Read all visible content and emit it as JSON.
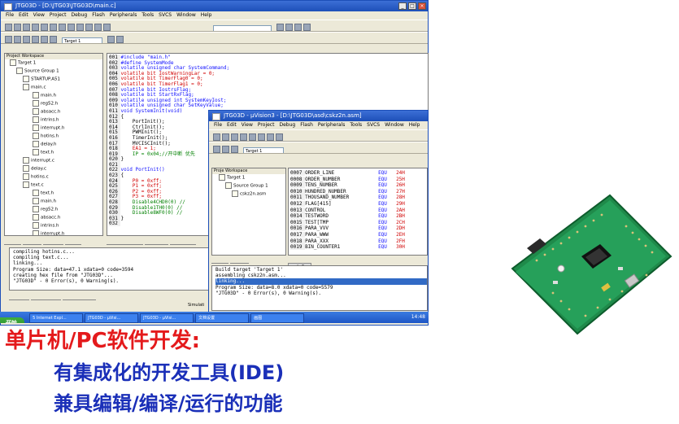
{
  "main_window": {
    "title": "JTG03D - [D:\\JTG03\\JTG03D\\main.c]",
    "menu": [
      "File",
      "Edit",
      "View",
      "Project",
      "Debug",
      "Flash",
      "Peripherals",
      "Tools",
      "SVCS",
      "Window",
      "Help"
    ],
    "target": "Target 1",
    "project_workspace_label": "Project Workspace",
    "tree": [
      "Target 1",
      "Source Group 1",
      "STARTUP.A51",
      "main.c",
      "main.h",
      "reg52.h",
      "absacc.h",
      "intrins.h",
      "interrupt.h",
      "hotins.h",
      "delay.h",
      "text.h",
      "interrupt.c",
      "delay.c",
      "hotins.c",
      "text.c",
      "text.h",
      "main.h",
      "reg52.h",
      "absacc.h",
      "intrins.h",
      "interrupt.h",
      "hotins.h",
      "delay.h"
    ],
    "code_lines": [
      {
        "n": "001",
        "t": "#include \"main.h\""
      },
      {
        "n": "002",
        "t": "#define SystemMode"
      },
      {
        "n": "003",
        "t": "volatile unsigned char SystemCommand;"
      },
      {
        "n": "004",
        "t": "volatile bit IostWarningLar = 0;"
      },
      {
        "n": "005",
        "t": "volatile bit TimerFlag0 = 0;"
      },
      {
        "n": "006",
        "t": "volatile bit TimerFlag1 = 0;"
      },
      {
        "n": "007",
        "t": "volatile bit IostrsFlag;"
      },
      {
        "n": "008",
        "t": "volatile bit StartRxFlag;"
      },
      {
        "n": "009",
        "t": "volatile unsigned int SystemKeyIost;"
      },
      {
        "n": "010",
        "t": "volatile unsigned char SetKeyValue;"
      },
      {
        "n": "011",
        "t": "void SystemInit(void)"
      },
      {
        "n": "012",
        "t": "{"
      },
      {
        "n": "013",
        "t": "    PortInit();"
      },
      {
        "n": "014",
        "t": "    CtrlInit();"
      },
      {
        "n": "015",
        "t": "    PWMInit();"
      },
      {
        "n": "016",
        "t": "    TimerInit();"
      },
      {
        "n": "017",
        "t": "    MVCISCInit();"
      },
      {
        "n": "018",
        "t": "    EA1 = 1;"
      },
      {
        "n": "019",
        "t": "    IP = 0x04;//开中断 优先"
      },
      {
        "n": "020",
        "t": "}"
      },
      {
        "n": "021",
        "t": ""
      },
      {
        "n": "022",
        "t": "void PortInit()"
      },
      {
        "n": "023",
        "t": "{"
      },
      {
        "n": "024",
        "t": "    P0 = 0xff;"
      },
      {
        "n": "025",
        "t": "    P1 = 0xff;"
      },
      {
        "n": "026",
        "t": "    P2 = 0xff;"
      },
      {
        "n": "027",
        "t": "    P3 = 0xff;"
      },
      {
        "n": "028",
        "t": "    Disable4CHD0(0) //"
      },
      {
        "n": "029",
        "t": "    Disable1TH0(0) //"
      },
      {
        "n": "030",
        "t": "    Disable8WF0(0) //"
      },
      {
        "n": "031",
        "t": "}"
      },
      {
        "n": "032",
        "t": ""
      }
    ],
    "left_tabs": [
      "Fi...",
      "Bo...",
      "{}F...",
      "0..."
    ],
    "editor_tabs": [
      "STARTUP.A51",
      "main.c",
      "interrup"
    ],
    "output_lines": [
      "compiling hotins.c...",
      "compiling text.c...",
      "linking...",
      "Program Size: data=47.1 xdata=0 code=3594",
      "creating hex file from \"JTG03D\"...",
      "\"JTG03D\" - 0 Error(s), 0 Warning(s)."
    ],
    "output_tabs": [
      "Build",
      "Command",
      "Find in Files"
    ]
  },
  "second_window": {
    "title": "JTG03D - μVision3 - [D:\\JTG03D\\asd\\cskz2n.asm]",
    "menu": [
      "File",
      "Edit",
      "View",
      "Project",
      "Debug",
      "Flash",
      "Peripherals",
      "Tools",
      "SVCS",
      "Window",
      "Help"
    ],
    "target": "Target 1",
    "workspace_label": "Proje Workspace",
    "tree": [
      "Target 1",
      "Source Group 1",
      "cskz2n.asm"
    ],
    "asm_lines": [
      {
        "n": "0007",
        "a": "ORDER_LINE",
        "op": "EQU",
        "v": "24H"
      },
      {
        "n": "0008",
        "a": "ORDER_NUMBER",
        "op": "EQU",
        "v": "25H"
      },
      {
        "n": "0009",
        "a": "TENS_NUMBER",
        "op": "EQU",
        "v": "26H"
      },
      {
        "n": "0010",
        "a": "HUNDRED_NUMBER",
        "op": "EQU",
        "v": "27H"
      },
      {
        "n": "0011",
        "a": "THOUSAND_NUMBER",
        "op": "EQU",
        "v": "28H"
      },
      {
        "n": "0012",
        "a": "FLAG[415]",
        "op": "EQU",
        "v": "29H"
      },
      {
        "n": "0013",
        "a": "CONTROL",
        "op": "EQU",
        "v": "2AH"
      },
      {
        "n": "0014",
        "a": "TESTWORD",
        "op": "EQU",
        "v": "2BH"
      },
      {
        "n": "0015",
        "a": "TEST[TMP",
        "op": "EQU",
        "v": "2CH"
      },
      {
        "n": "0016",
        "a": "PARA_VVV",
        "op": "EQU",
        "v": "2DH"
      },
      {
        "n": "0017",
        "a": "PARA_WWW",
        "op": "EQU",
        "v": "2EH"
      },
      {
        "n": "0018",
        "a": "PARA_XXX",
        "op": "EQU",
        "v": "2FH"
      },
      {
        "n": "0019",
        "a": "BIN_COUNTER1",
        "op": "EQU",
        "v": "30H"
      }
    ],
    "left_tabs": [
      "Fi...",
      "Re..."
    ],
    "editor_tab": "cskz2n",
    "output_lines": [
      "Build target 'Target 1'",
      "assembling cskz2n.asm...",
      "linking...",
      "Program Size: data=8.0 xdata=0 code=5579",
      "\"JTG03D\" - 0 Error(s), 0 Warning(s)."
    ]
  },
  "taskbar": {
    "start": "开始",
    "tasks": [
      "5 Internet Expl...",
      "JTG03D - μVisi...",
      "JTG03D - μVisi...",
      "文档设置",
      "画图"
    ],
    "clock": "14:48"
  },
  "statusbar": "Simulati",
  "captions": {
    "heading": "单片机/PC软件开发:",
    "line1": "有集成化的开发工具(IDE)",
    "line2": "兼具编辑/编译/运行的功能"
  },
  "colors": {
    "caption_red": "#e41a1c",
    "caption_blue": "#1a2fb8",
    "board_green": "#1f8a4a"
  }
}
